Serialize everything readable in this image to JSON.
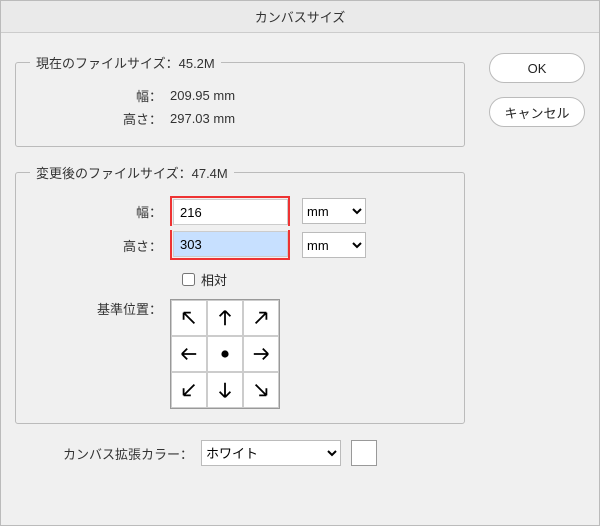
{
  "title": "カンバスサイズ",
  "buttons": {
    "ok": "OK",
    "cancel": "キャンセル"
  },
  "current": {
    "legend": "現在のファイルサイズ：45.2M",
    "width_label": "幅：",
    "width_value": "209.95 mm",
    "height_label": "高さ：",
    "height_value": "297.03 mm"
  },
  "new_size": {
    "legend": "変更後のファイルサイズ：47.4M",
    "width_label": "幅：",
    "width_value": "216",
    "height_label": "高さ：",
    "height_value": "303",
    "unit_width": "mm",
    "unit_height": "mm",
    "relative_label": "相対",
    "anchor_label": "基準位置："
  },
  "extension": {
    "label": "カンバス拡張カラー：",
    "value": "ホワイト",
    "swatch": "#ffffff"
  }
}
